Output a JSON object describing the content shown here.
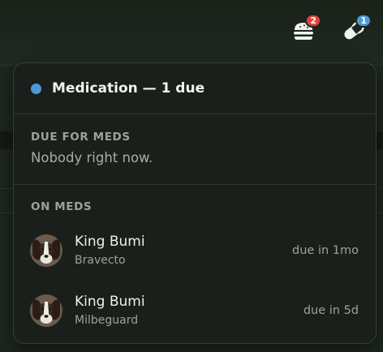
{
  "topbar": {
    "feeding_badge": "2",
    "meds_badge": "1"
  },
  "colors": {
    "feeding_badge": "#e0443c",
    "meds_badge": "#4e9ad6",
    "status_dot": "#4e9ad6"
  },
  "icons": {
    "feeding": "burger-icon",
    "meds": "pill-icon",
    "avatar": "dog-avatar"
  },
  "panel": {
    "title": "Medication — 1 due",
    "due_section": {
      "label": "DUE FOR MEDS",
      "empty_text": "Nobody right now."
    },
    "on_meds_section": {
      "label": "ON MEDS",
      "items": [
        {
          "name": "King Bumi",
          "medication": "Bravecto",
          "due": "due in 1mo"
        },
        {
          "name": "King Bumi",
          "medication": "Milbeguard",
          "due": "due in 5d"
        }
      ]
    }
  }
}
